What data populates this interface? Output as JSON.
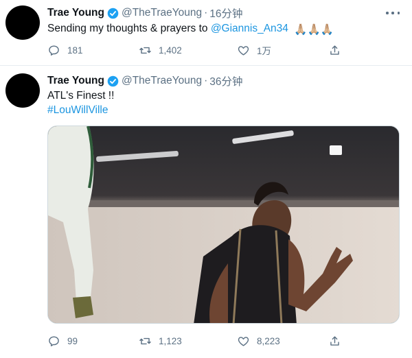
{
  "tweets": [
    {
      "author_name": "Trae Young",
      "handle": "@TheTraeYoung",
      "separator": "·",
      "time": "16分钟",
      "text": "Sending my thoughts & prayers to",
      "mention": "@Giannis_An34",
      "emoji": "🙏🏼🙏🏼🙏🏼",
      "replies": "181",
      "retweets": "1,402",
      "likes": "1万"
    },
    {
      "author_name": "Trae Young",
      "handle": "@TheTraeYoung",
      "separator": "·",
      "time": "36分钟",
      "text": "ATL's Finest !!",
      "hashtag": "#LouWillVille",
      "replies": "99",
      "retweets": "1,123",
      "likes": "8,223"
    }
  ],
  "colors": {
    "text": "#0f1419",
    "secondary": "#5b7083",
    "link": "#1b95e0",
    "verified": "#1da1f2",
    "divider": "#e6ecf0"
  },
  "icons": [
    "verified-badge-icon",
    "more-options-icon",
    "reply-icon",
    "retweet-icon",
    "like-icon",
    "share-icon"
  ]
}
